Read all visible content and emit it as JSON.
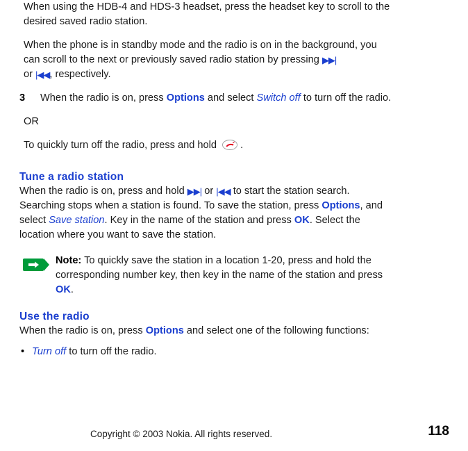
{
  "document": {
    "paragraphs": {
      "p1": "When using the HDB-4 and HDS-3 headset, press the headset key to scroll to the desired saved radio station.",
      "p2a": "When the phone is in standby mode and the radio is on in the background, you can scroll to the next or previously saved radio station by pressing",
      "p2b": "or",
      "p2c": ", respectively.",
      "or": "OR",
      "quick_off_a": "To quickly turn off the radio, press and hold",
      "quick_off_b": "."
    },
    "step3": {
      "number": "3",
      "text_a": "When the radio is on, press",
      "options": "Options",
      "text_b": "and select",
      "switch_off": "Switch off",
      "text_c": "to turn off the radio."
    },
    "tune_section": {
      "heading": "Tune a radio station",
      "text_a": "When the radio is on, press and hold",
      "text_or": "or",
      "text_b": "to start the station search. Searching stops when a station is found. To save the station, press",
      "options": "Options",
      "text_c": ", and select",
      "save_station": "Save station",
      "text_d": ". Key in the name of the station and press",
      "ok": "OK",
      "text_e": ". Select the location where you want to save the station."
    },
    "note": {
      "label": "Note:",
      "text_a": "To quickly save the station in a location 1-20, press and hold the corresponding number key, then key in the name of the station and press",
      "ok": "OK",
      "text_b": "."
    },
    "use_section": {
      "heading": "Use the radio",
      "text_a": "When the radio is on, press",
      "options": "Options",
      "text_b": "and select one of the following functions:"
    },
    "bullets": [
      {
        "marker": "•",
        "italic_label": "Turn off",
        "text": "to turn off the radio."
      }
    ],
    "footer": {
      "copyright": "Copyright © 2003 Nokia. All rights reserved.",
      "page_number": "118"
    },
    "icons": {
      "fast_forward": "fast-forward-icon",
      "rewind": "rewind-icon",
      "end_call": "end-call-key-icon",
      "note": "note-hand-icon"
    },
    "colors": {
      "accent_blue": "#1b3fcf",
      "text": "#1a1a1a",
      "note_green": "#009b3a",
      "end_key_red": "#e2001a"
    }
  }
}
